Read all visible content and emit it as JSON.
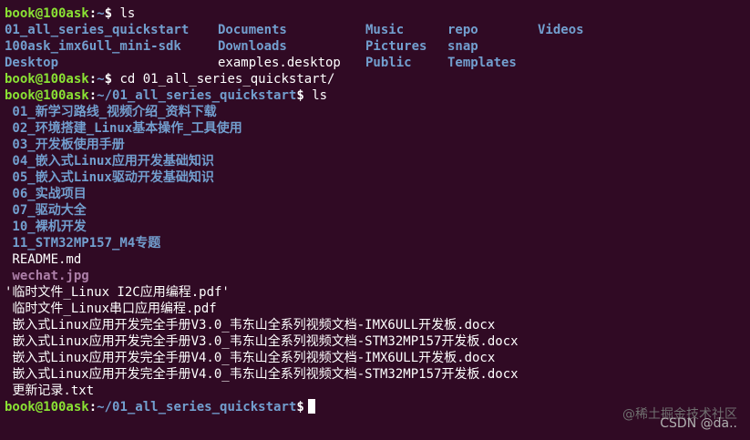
{
  "prompt": {
    "user_host": "book@100ask",
    "sep": ":",
    "home_path": "~",
    "qs_path": "~/01_all_series_quickstart",
    "symbol": "$"
  },
  "commands": {
    "ls1": "ls",
    "cd": "cd 01_all_series_quickstart/",
    "ls2": "ls"
  },
  "home_listing": [
    [
      "01_all_series_quickstart",
      "Documents",
      "Music",
      "repo",
      "Videos"
    ],
    [
      "100ask_imx6ull_mini-sdk",
      "Downloads",
      "Pictures",
      "snap",
      ""
    ],
    [
      "Desktop",
      "examples.desktop",
      "Public",
      "Templates",
      ""
    ]
  ],
  "quickstart_listing": [
    {
      "name": " 01_新学习路线_视频介绍_资料下载",
      "type": "dir"
    },
    {
      "name": " 02_环境搭建_Linux基本操作_工具使用",
      "type": "dir"
    },
    {
      "name": " 03_开发板使用手册",
      "type": "dir"
    },
    {
      "name": " 04_嵌入式Linux应用开发基础知识",
      "type": "dir"
    },
    {
      "name": " 05_嵌入式Linux驱动开发基础知识",
      "type": "dir"
    },
    {
      "name": " 06_实战项目",
      "type": "dir"
    },
    {
      "name": " 07_驱动大全",
      "type": "dir"
    },
    {
      "name": " 10_裸机开发",
      "type": "dir"
    },
    {
      "name": " 11_STM32MP157_M4专题",
      "type": "dir"
    },
    {
      "name": " README.md",
      "type": "file"
    },
    {
      "name": " wechat.jpg",
      "type": "image"
    },
    {
      "name": "'临时文件_Linux I2C应用编程.pdf'",
      "type": "file"
    },
    {
      "name": " 临时文件_Linux串口应用编程.pdf",
      "type": "file"
    },
    {
      "name": " 嵌入式Linux应用开发完全手册V3.0_韦东山全系列视频文档-IMX6ULL开发板.docx",
      "type": "file"
    },
    {
      "name": " 嵌入式Linux应用开发完全手册V3.0_韦东山全系列视频文档-STM32MP157开发板.docx",
      "type": "file"
    },
    {
      "name": " 嵌入式Linux应用开发完全手册V4.0_韦东山全系列视频文档-IMX6ULL开发板.docx",
      "type": "file"
    },
    {
      "name": " 嵌入式Linux应用开发完全手册V4.0_韦东山全系列视频文档-STM32MP157开发板.docx",
      "type": "file"
    },
    {
      "name": " 更新记录.txt",
      "type": "file"
    }
  ],
  "watermark": {
    "line1": "@稀土掘金技术社区",
    "line2": "CSDN @da.."
  },
  "colors": {
    "background": "#300a24",
    "prompt": "#8ae234",
    "directory": "#729fcf",
    "image": "#ad7fa8"
  }
}
